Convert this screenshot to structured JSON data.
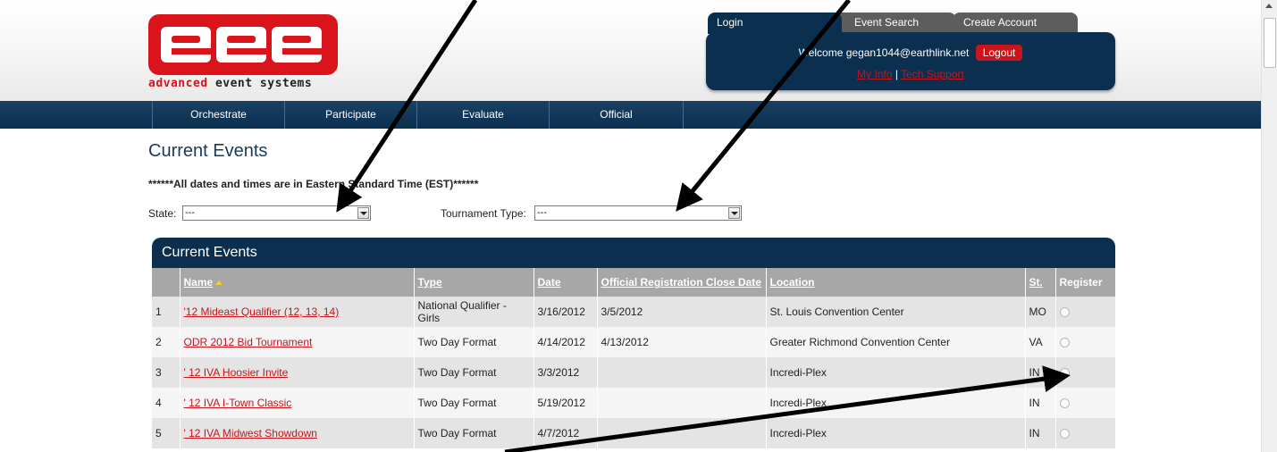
{
  "logo": {
    "word_red": "advanced",
    "word_rest": " event systems"
  },
  "account": {
    "tabs": {
      "login": "Login",
      "event_search": "Event Search",
      "create_account": "Create Account"
    },
    "welcome_prefix": "Welcome gegan1044@earthlink.net",
    "logout_label": "Logout",
    "my_info": "My Info",
    "separator": "|",
    "tech_support": "Tech Support"
  },
  "nav": {
    "items": [
      "Orchestrate",
      "Participate",
      "Evaluate",
      "Official"
    ]
  },
  "page": {
    "title": "Current Events",
    "timezone_note": "******All dates and times are in Eastern Standard Time (EST)******"
  },
  "filters": {
    "state_label": "State:",
    "state_value": "---",
    "tournament_type_label": "Tournament Type:",
    "tournament_type_value": "---"
  },
  "events_panel": {
    "title": "Current Events",
    "columns": {
      "name": "Name",
      "type": "Type",
      "date": "Date",
      "close_date": "Official Registration Close Date",
      "location": "Location",
      "state": "St.",
      "register": "Register"
    },
    "rows": [
      {
        "num": "1",
        "name": "'12 Mideast Qualifier (12, 13, 14)",
        "type": "National Qualifier - Girls",
        "date": "3/16/2012",
        "close_date": "3/5/2012",
        "location": "St. Louis Convention Center",
        "state": "MO"
      },
      {
        "num": "2",
        "name": "ODR 2012 Bid Tournament",
        "type": "Two Day Format",
        "date": "4/14/2012",
        "close_date": "4/13/2012",
        "location": "Greater Richmond Convention Center",
        "state": "VA"
      },
      {
        "num": "3",
        "name": "' 12 IVA Hoosier Invite",
        "type": "Two Day Format",
        "date": "3/3/2012",
        "close_date": "",
        "location": "Incredi-Plex",
        "state": "IN"
      },
      {
        "num": "4",
        "name": "' 12 IVA I-Town Classic",
        "type": "Two Day Format",
        "date": "5/19/2012",
        "close_date": "",
        "location": "Incredi-Plex",
        "state": "IN"
      },
      {
        "num": "5",
        "name": "' 12 IVA Midwest Showdown",
        "type": "Two Day Format",
        "date": "4/7/2012",
        "close_date": "",
        "location": "Incredi-Plex",
        "state": "IN"
      }
    ]
  },
  "colors": {
    "navy": "#0b2f4f",
    "brand_red": "#d9151b",
    "link_red": "#c9141b",
    "header_gray": "#a7a7a7"
  }
}
